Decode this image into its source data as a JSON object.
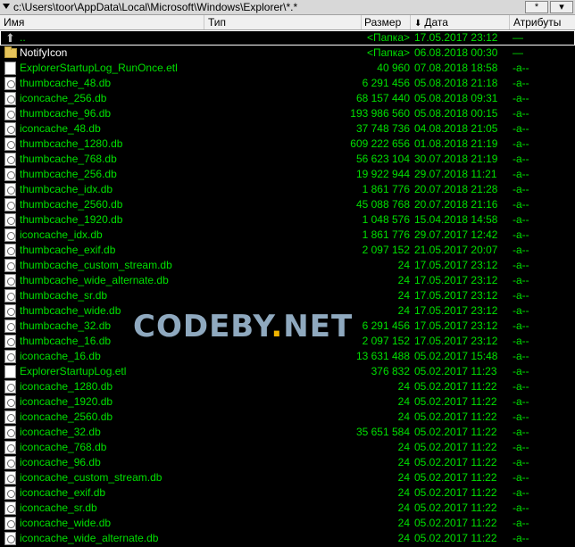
{
  "path_bar": {
    "path": "c:\\Users\\toor\\AppData\\Local\\Microsoft\\Windows\\Explorer\\*.*",
    "button_1": "*",
    "button_2": "▾"
  },
  "columns": {
    "name": "Имя",
    "type": "Тип",
    "size": "Размер",
    "date": "Дата",
    "attributes": "Атрибуты",
    "sort_arrow": "⬇"
  },
  "rows": [
    {
      "name": "..",
      "size": "<Папка>",
      "date": "17.05.2017 23:12",
      "attr": "—",
      "icon": "up-icon",
      "kind": "up"
    },
    {
      "name": "NotifyIcon",
      "size": "<Папка>",
      "date": "06.08.2018 00:30",
      "attr": "—",
      "icon": "folder-icon",
      "kind": "dir"
    },
    {
      "name": "ExplorerStartupLog_RunOnce.etl",
      "size": "40 960",
      "date": "07.08.2018 18:58",
      "attr": "-a--",
      "icon": "document-icon",
      "kind": "file"
    },
    {
      "name": "thumbcache_48.db",
      "size": "6 291 456",
      "date": "05.08.2018 21:18",
      "attr": "-a--",
      "icon": "database-icon",
      "kind": "file"
    },
    {
      "name": "iconcache_256.db",
      "size": "68 157 440",
      "date": "05.08.2018 09:31",
      "attr": "-a--",
      "icon": "database-icon",
      "kind": "file"
    },
    {
      "name": "thumbcache_96.db",
      "size": "193 986 560",
      "date": "05.08.2018 00:15",
      "attr": "-a--",
      "icon": "database-icon",
      "kind": "file"
    },
    {
      "name": "iconcache_48.db",
      "size": "37 748 736",
      "date": "04.08.2018 21:05",
      "attr": "-a--",
      "icon": "database-icon",
      "kind": "file"
    },
    {
      "name": "thumbcache_1280.db",
      "size": "609 222 656",
      "date": "01.08.2018 21:19",
      "attr": "-a--",
      "icon": "database-icon",
      "kind": "file"
    },
    {
      "name": "thumbcache_768.db",
      "size": "56 623 104",
      "date": "30.07.2018 21:19",
      "attr": "-a--",
      "icon": "database-icon",
      "kind": "file"
    },
    {
      "name": "thumbcache_256.db",
      "size": "19 922 944",
      "date": "29.07.2018 11:21",
      "attr": "-a--",
      "icon": "database-icon",
      "kind": "file"
    },
    {
      "name": "thumbcache_idx.db",
      "size": "1 861 776",
      "date": "20.07.2018 21:28",
      "attr": "-a--",
      "icon": "database-icon",
      "kind": "file"
    },
    {
      "name": "thumbcache_2560.db",
      "size": "45 088 768",
      "date": "20.07.2018 21:16",
      "attr": "-a--",
      "icon": "database-icon",
      "kind": "file"
    },
    {
      "name": "thumbcache_1920.db",
      "size": "1 048 576",
      "date": "15.04.2018 14:58",
      "attr": "-a--",
      "icon": "database-icon",
      "kind": "file"
    },
    {
      "name": "iconcache_idx.db",
      "size": "1 861 776",
      "date": "29.07.2017 12:42",
      "attr": "-a--",
      "icon": "database-icon",
      "kind": "file"
    },
    {
      "name": "thumbcache_exif.db",
      "size": "2 097 152",
      "date": "21.05.2017 20:07",
      "attr": "-a--",
      "icon": "database-icon",
      "kind": "file"
    },
    {
      "name": "thumbcache_custom_stream.db",
      "size": "24",
      "date": "17.05.2017 23:12",
      "attr": "-a--",
      "icon": "database-icon",
      "kind": "file"
    },
    {
      "name": "thumbcache_wide_alternate.db",
      "size": "24",
      "date": "17.05.2017 23:12",
      "attr": "-a--",
      "icon": "database-icon",
      "kind": "file"
    },
    {
      "name": "thumbcache_sr.db",
      "size": "24",
      "date": "17.05.2017 23:12",
      "attr": "-a--",
      "icon": "database-icon",
      "kind": "file"
    },
    {
      "name": "thumbcache_wide.db",
      "size": "24",
      "date": "17.05.2017 23:12",
      "attr": "-a--",
      "icon": "database-icon",
      "kind": "file"
    },
    {
      "name": "thumbcache_32.db",
      "size": "6 291 456",
      "date": "17.05.2017 23:12",
      "attr": "-a--",
      "icon": "database-icon",
      "kind": "file"
    },
    {
      "name": "thumbcache_16.db",
      "size": "2 097 152",
      "date": "17.05.2017 23:12",
      "attr": "-a--",
      "icon": "database-icon",
      "kind": "file"
    },
    {
      "name": "iconcache_16.db",
      "size": "13 631 488",
      "date": "05.02.2017 15:48",
      "attr": "-a--",
      "icon": "database-icon",
      "kind": "file"
    },
    {
      "name": "ExplorerStartupLog.etl",
      "size": "376 832",
      "date": "05.02.2017 11:23",
      "attr": "-a--",
      "icon": "document-icon",
      "kind": "file"
    },
    {
      "name": "iconcache_1280.db",
      "size": "24",
      "date": "05.02.2017 11:22",
      "attr": "-a--",
      "icon": "database-icon",
      "kind": "file"
    },
    {
      "name": "iconcache_1920.db",
      "size": "24",
      "date": "05.02.2017 11:22",
      "attr": "-a--",
      "icon": "database-icon",
      "kind": "file"
    },
    {
      "name": "iconcache_2560.db",
      "size": "24",
      "date": "05.02.2017 11:22",
      "attr": "-a--",
      "icon": "database-icon",
      "kind": "file"
    },
    {
      "name": "iconcache_32.db",
      "size": "35 651 584",
      "date": "05.02.2017 11:22",
      "attr": "-a--",
      "icon": "database-icon",
      "kind": "file"
    },
    {
      "name": "iconcache_768.db",
      "size": "24",
      "date": "05.02.2017 11:22",
      "attr": "-a--",
      "icon": "database-icon",
      "kind": "file"
    },
    {
      "name": "iconcache_96.db",
      "size": "24",
      "date": "05.02.2017 11:22",
      "attr": "-a--",
      "icon": "database-icon",
      "kind": "file"
    },
    {
      "name": "iconcache_custom_stream.db",
      "size": "24",
      "date": "05.02.2017 11:22",
      "attr": "-a--",
      "icon": "database-icon",
      "kind": "file"
    },
    {
      "name": "iconcache_exif.db",
      "size": "24",
      "date": "05.02.2017 11:22",
      "attr": "-a--",
      "icon": "database-icon",
      "kind": "file"
    },
    {
      "name": "iconcache_sr.db",
      "size": "24",
      "date": "05.02.2017 11:22",
      "attr": "-a--",
      "icon": "database-icon",
      "kind": "file"
    },
    {
      "name": "iconcache_wide.db",
      "size": "24",
      "date": "05.02.2017 11:22",
      "attr": "-a--",
      "icon": "database-icon",
      "kind": "file"
    },
    {
      "name": "iconcache_wide_alternate.db",
      "size": "24",
      "date": "05.02.2017 11:22",
      "attr": "-a--",
      "icon": "database-icon",
      "kind": "file"
    }
  ],
  "watermark": {
    "part1": "CODEBY",
    "dot": ".",
    "part2": "NET"
  },
  "colors": {
    "background": "#000000",
    "file_text": "#00e000",
    "watermark": "#8fa9bf",
    "watermark_dot": "#f0b400"
  }
}
